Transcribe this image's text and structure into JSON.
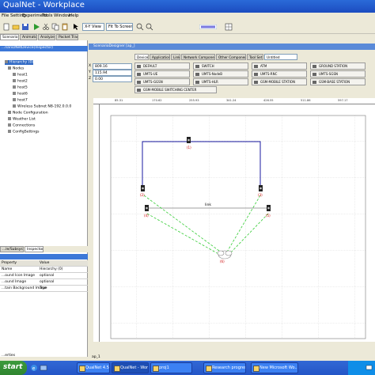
{
  "window": {
    "title": "QualNet - Workplace"
  },
  "menu": [
    "File",
    "Setting",
    "Experiment",
    "Tools",
    "Window",
    "Help"
  ],
  "toolbar": {
    "view_select": "X-Y View",
    "zoom_select": "Fit To Screen"
  },
  "top_tabs": [
    "Scenario Designer",
    "Animator",
    "Analyzer",
    "Packet Tracer"
  ],
  "left_panel": {
    "header": "...nario/NetDevice(Inspector)",
    "tree": [
      "Hierarchy (0)",
      "Nodes",
      "host1",
      "host2",
      "host5",
      "host6",
      "host7",
      "Wireless Subnet N8-192.0.0.0",
      "Node Configuration",
      "Weather List",
      "Connections",
      "ConfigSettings"
    ]
  },
  "props_panel": {
    "tabs": [
      "...le/Subsystems",
      "Inspector"
    ],
    "columns": [
      "Property",
      "Value"
    ],
    "rows": [
      {
        "name": "Name",
        "value": "Hierarchy (0)"
      },
      {
        "name": "...ound Icon Image",
        "value": "optional"
      },
      {
        "name": "...ound Image",
        "value": "optional"
      },
      {
        "name": "...tain Background Image",
        "value": "True"
      }
    ],
    "footer": "...erties"
  },
  "canvas": {
    "header": "ScenarioDesigner [ap_]",
    "coords": {
      "x_label": "X",
      "x": "809.16",
      "y_label": "Y",
      "y": "115.94",
      "z_label": "Z",
      "z": "0.00"
    },
    "tabs": [
      "Devices",
      "Applications",
      "Links",
      "Network Components",
      "Other Components",
      "Tool Set"
    ],
    "toolset_value": "Untitled",
    "device_buttons": [
      "DEFAULT",
      "SWITCH",
      "ATM",
      "GROUND STATION",
      "UMTS-UE",
      "UMTS-NodeB",
      "UMTS-RNC",
      "UMTS-SGSN",
      "UMTS-GGSN",
      "UMTS-HLR",
      "GSM-MOBILE STATION",
      "GSM-BASE STATION",
      "GSM-MOBILE SWITCHING CENTER"
    ],
    "ruler_labels": [
      "85.31",
      "170.62",
      "255.93",
      "341.24",
      "426.55",
      "511.86",
      "597.17"
    ],
    "link_label": "link",
    "node_labels": [
      "(1)",
      "(2)",
      "(3)",
      "(4)",
      "(5)",
      "(6)"
    ],
    "status": "ap_1"
  },
  "taskbar": {
    "start": "start",
    "buttons": [
      "QualNet 4.5 Devel...",
      "QualNet - Workpl...",
      "proj1",
      "Research progres...",
      "New Microsoft Wo..."
    ]
  },
  "colors": {
    "link": "#1a1aa0",
    "wireless": "#33cc33",
    "grid": "#b8b8b8"
  }
}
